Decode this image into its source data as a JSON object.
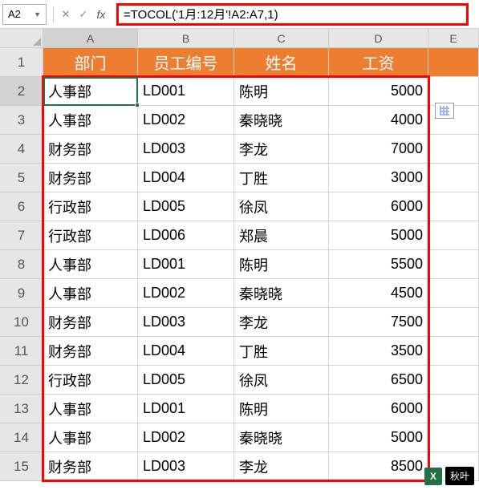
{
  "formulaBar": {
    "nameBox": "A2",
    "formula": "=TOCOL('1月:12月'!A2:A7,1)"
  },
  "columns": [
    "A",
    "B",
    "C",
    "D",
    "E"
  ],
  "headerRow": {
    "dept": "部门",
    "empId": "员工编号",
    "name": "姓名",
    "salary": "工资"
  },
  "rows": [
    {
      "num": "1"
    },
    {
      "num": "2",
      "dept": "人事部",
      "empId": "LD001",
      "name": "陈明",
      "salary": "5000"
    },
    {
      "num": "3",
      "dept": "人事部",
      "empId": "LD002",
      "name": "秦晓晓",
      "salary": "4000"
    },
    {
      "num": "4",
      "dept": "财务部",
      "empId": "LD003",
      "name": "李龙",
      "salary": "7000"
    },
    {
      "num": "5",
      "dept": "财务部",
      "empId": "LD004",
      "name": "丁胜",
      "salary": "3000"
    },
    {
      "num": "6",
      "dept": "行政部",
      "empId": "LD005",
      "name": "徐凤",
      "salary": "6000"
    },
    {
      "num": "7",
      "dept": "行政部",
      "empId": "LD006",
      "name": "郑晨",
      "salary": "5000"
    },
    {
      "num": "8",
      "dept": "人事部",
      "empId": "LD001",
      "name": "陈明",
      "salary": "5500"
    },
    {
      "num": "9",
      "dept": "人事部",
      "empId": "LD002",
      "name": "秦晓晓",
      "salary": "4500"
    },
    {
      "num": "10",
      "dept": "财务部",
      "empId": "LD003",
      "name": "李龙",
      "salary": "7500"
    },
    {
      "num": "11",
      "dept": "财务部",
      "empId": "LD004",
      "name": "丁胜",
      "salary": "3500"
    },
    {
      "num": "12",
      "dept": "行政部",
      "empId": "LD005",
      "name": "徐凤",
      "salary": "6500"
    },
    {
      "num": "13",
      "dept": "人事部",
      "empId": "LD001",
      "name": "陈明",
      "salary": "6000"
    },
    {
      "num": "14",
      "dept": "人事部",
      "empId": "LD002",
      "name": "秦晓晓",
      "salary": "5000"
    },
    {
      "num": "15",
      "dept": "财务部",
      "empId": "LD003",
      "name": "李龙",
      "salary": "8500"
    }
  ],
  "watermark": {
    "logo": "X",
    "text": "秋叶"
  },
  "activeCell": "A2",
  "chart_data": {
    "type": "table",
    "title": "",
    "columns": [
      "部门",
      "员工编号",
      "姓名",
      "工资"
    ],
    "data": [
      [
        "人事部",
        "LD001",
        "陈明",
        5000
      ],
      [
        "人事部",
        "LD002",
        "秦晓晓",
        4000
      ],
      [
        "财务部",
        "LD003",
        "李龙",
        7000
      ],
      [
        "财务部",
        "LD004",
        "丁胜",
        3000
      ],
      [
        "行政部",
        "LD005",
        "徐凤",
        6000
      ],
      [
        "行政部",
        "LD006",
        "郑晨",
        5000
      ],
      [
        "人事部",
        "LD001",
        "陈明",
        5500
      ],
      [
        "人事部",
        "LD002",
        "秦晓晓",
        4500
      ],
      [
        "财务部",
        "LD003",
        "李龙",
        7500
      ],
      [
        "财务部",
        "LD004",
        "丁胜",
        3500
      ],
      [
        "行政部",
        "LD005",
        "徐凤",
        6500
      ],
      [
        "人事部",
        "LD001",
        "陈明",
        6000
      ],
      [
        "人事部",
        "LD002",
        "秦晓晓",
        5000
      ],
      [
        "财务部",
        "LD003",
        "李龙",
        8500
      ]
    ]
  }
}
